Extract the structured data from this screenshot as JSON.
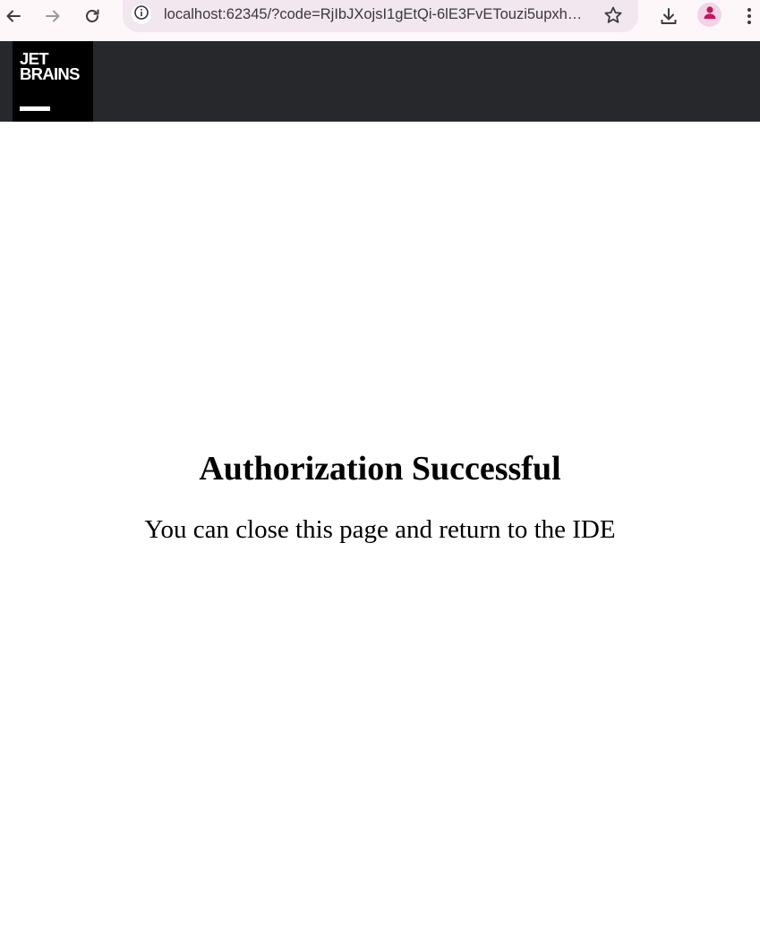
{
  "browser": {
    "url": "localhost:62345/?code=RjIbJXojsI1gEtQi-6lE3FvETouzi5upxh…",
    "icons": {
      "back": "arrow-left-icon",
      "forward": "arrow-right-icon",
      "reload": "reload-icon",
      "site_info": "info-icon",
      "bookmark": "star-icon",
      "download": "download-icon",
      "profile": "person-icon",
      "menu": "kebab-menu-icon"
    },
    "colors": {
      "toolbar_bg": "#fdf7f9",
      "omnibox_bg": "#f2e6ef",
      "profile_accent": "#c2185b"
    }
  },
  "header": {
    "logo_line1": "JET",
    "logo_line2": "BRAINS",
    "colors": {
      "header_bg": "#27282c",
      "logo_bg": "#000000"
    }
  },
  "main": {
    "title": "Authorization Successful",
    "message": "You can close this page and return to the IDE"
  }
}
